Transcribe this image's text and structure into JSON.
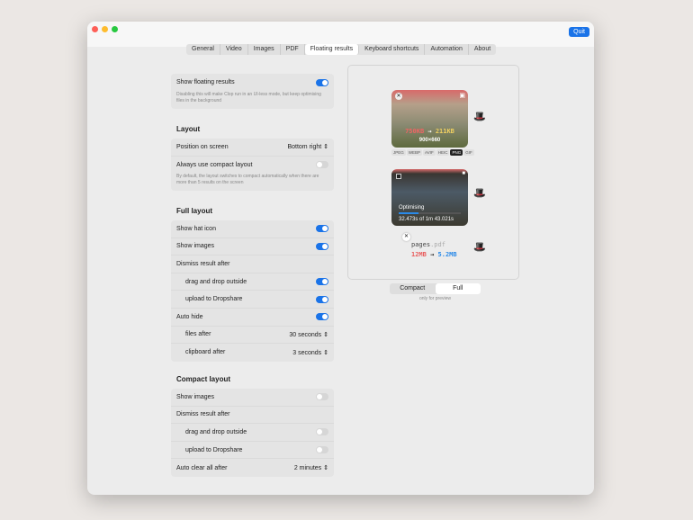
{
  "window": {
    "quit_label": "Quit"
  },
  "tabs": [
    "General",
    "Video",
    "Images",
    "PDF",
    "Floating results",
    "Keyboard shortcuts",
    "Automation",
    "About"
  ],
  "active_tab": "Floating results",
  "floating": {
    "label": "Show floating results",
    "desc": "Disabling this will make Clop run in an UI-less mode, but keep optimising files in the background"
  },
  "layout": {
    "heading": "Layout",
    "position_label": "Position on screen",
    "position_value": "Bottom right",
    "compact_label": "Always use compact layout",
    "compact_desc": "By default, the layout switches to compact automatically when there are more than 5 results on the screen"
  },
  "full": {
    "heading": "Full layout",
    "rows": [
      {
        "label": "Show hat icon",
        "type": "toggle",
        "on": true
      },
      {
        "label": "Show images",
        "type": "toggle",
        "on": true
      },
      {
        "label": "Dismiss result after",
        "type": "none"
      },
      {
        "label": "drag and drop outside",
        "type": "toggle",
        "on": true,
        "indent": true
      },
      {
        "label": "upload to Dropshare",
        "type": "toggle",
        "on": true,
        "indent": true
      },
      {
        "label": "Auto hide",
        "type": "toggle",
        "on": true
      },
      {
        "label": "files after",
        "type": "select",
        "value": "30 seconds",
        "indent": true
      },
      {
        "label": "clipboard after",
        "type": "select",
        "value": "3 seconds",
        "indent": true
      }
    ]
  },
  "compact": {
    "heading": "Compact layout",
    "rows": [
      {
        "label": "Show images",
        "type": "toggle",
        "on": false
      },
      {
        "label": "Dismiss result after",
        "type": "none"
      },
      {
        "label": "drag and drop outside",
        "type": "toggle",
        "on": false,
        "indent": true
      },
      {
        "label": "upload to Dropshare",
        "type": "toggle",
        "on": false,
        "indent": true
      },
      {
        "label": "Auto clear all after",
        "type": "select",
        "value": "2 minutes"
      }
    ]
  },
  "preview": {
    "image": {
      "from": "750KB",
      "arrow": "→",
      "to": "211KB",
      "dims": "900×660",
      "formats": [
        "JPEG",
        "WEBP",
        "AVIF",
        "HEIC",
        "PNG",
        "GIF"
      ],
      "active_format": "PNG"
    },
    "video": {
      "status": "Optimising",
      "progress": 0.32,
      "time": "32.473s of 1m 43.021s"
    },
    "pdf": {
      "name": "pages",
      "ext": ".pdf",
      "from": "12MB",
      "arrow": "→",
      "to": "5.2MB"
    },
    "segment": [
      "Compact",
      "Full"
    ],
    "segment_active": "Full",
    "note": "only for preview"
  }
}
